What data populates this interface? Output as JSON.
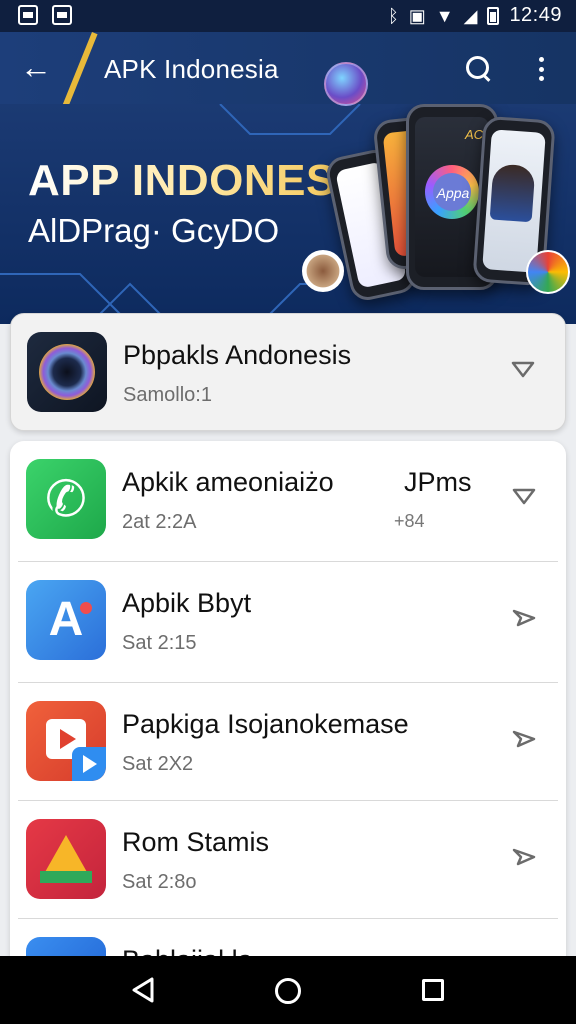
{
  "status_bar": {
    "time": "12:49",
    "left_icons": [
      "image-notification-icon",
      "screenshot-notification-icon"
    ],
    "right_icons": [
      "bluetooth-icon",
      "photo-icon",
      "wifi-icon",
      "signal-icon",
      "battery-icon"
    ]
  },
  "app_bar": {
    "title": "APK Indonesia",
    "back_icon": "arrow-left",
    "search_icon": "search",
    "menu_icon": "more-vertical"
  },
  "banner": {
    "title": "APP INDONESIA",
    "subtitle": "AlDPrag· GcyDO",
    "phone_logo": "Appa",
    "phone_letter": "AC"
  },
  "featured": {
    "title": "Pbpakls Andonesis",
    "subtitle": "Samollo:1",
    "icon": "camera-icon"
  },
  "list": [
    {
      "title": "Apkik ameoniaiżo",
      "extra": "JPms",
      "subtitle": "2at 2:2A",
      "extra_sub": "+84",
      "icon": "phone-icon"
    },
    {
      "title": "Apbik Bbyt",
      "subtitle": "Sat 2:15",
      "icon": "app-builder-icon"
    },
    {
      "title": "Papkiga Isojanokemase",
      "subtitle": "Sat 2X2",
      "icon": "video-player-icon"
    },
    {
      "title": "Rom Stamis",
      "subtitle": "Sat 2:8o",
      "icon": "drive-icon"
    },
    {
      "title": "Bablaiial la",
      "subtitle": "",
      "icon": "partial-app-icon"
    }
  ],
  "colors": {
    "app_bar": "#1d3e7a",
    "accent_slash": "#e8b93a",
    "status_bar": "#0f1f3f",
    "nav_bar": "#000000"
  }
}
